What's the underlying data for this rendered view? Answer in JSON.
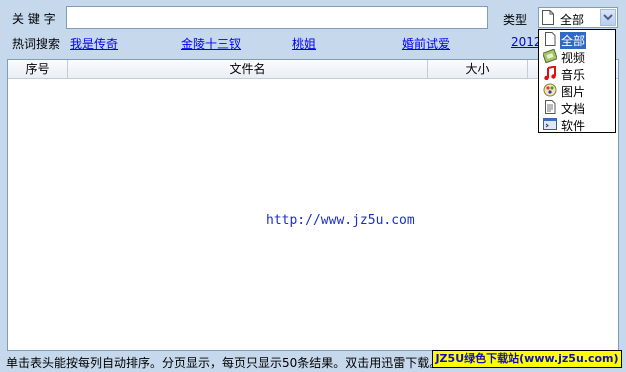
{
  "search": {
    "keyword_label": "关 键 字",
    "value": ""
  },
  "hot": {
    "label": "热词搜索",
    "links": [
      "我是传奇",
      "金陵十三钗",
      "桃姐",
      "婚前试爱",
      "2012"
    ]
  },
  "type_select": {
    "label": "类型",
    "selected": "全部",
    "options": [
      {
        "label": "全部",
        "icon": "document-icon"
      },
      {
        "label": "视频",
        "icon": "video-icon"
      },
      {
        "label": "音乐",
        "icon": "music-note-icon"
      },
      {
        "label": "图片",
        "icon": "image-icon"
      },
      {
        "label": "文档",
        "icon": "text-document-icon"
      },
      {
        "label": "软件",
        "icon": "software-icon"
      }
    ]
  },
  "table": {
    "columns": [
      "序号",
      "文件名",
      "大小"
    ]
  },
  "watermark": "http://www.jz5u.com",
  "status_text": "单击表头能按每列自动排序。分页显示，每页只显示50条结果。双击用迅雷下载。",
  "badge": "JZ5U绿色下载站(www.jz5u.com)",
  "colors": {
    "background": "#c6d8ec",
    "link": "#0000ee",
    "selection": "#316ac5",
    "badge": "#ffff00"
  }
}
